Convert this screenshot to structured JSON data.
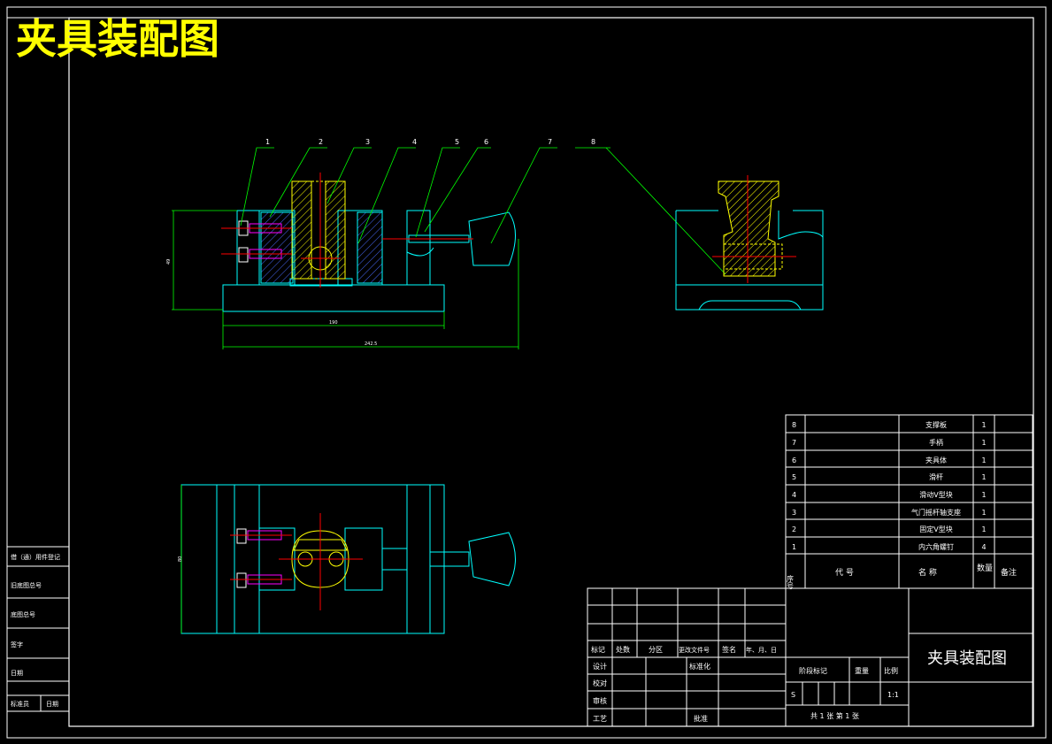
{
  "drawing_title": "夹具装配图",
  "colors": {
    "background": "#000000",
    "border": "#ffffff",
    "outline": "#00ffff",
    "leader": "#00ff00",
    "section": "#ffff00",
    "centerline": "#ff0000",
    "bolt": "#ff00ff"
  },
  "balloons": [
    "1",
    "2",
    "3",
    "4",
    "5",
    "6",
    "7",
    "8"
  ],
  "dims": {
    "height": "49",
    "length_base": "190",
    "length_total": "242.5",
    "width_plan": "80"
  },
  "left_strip": [
    "借（通）用件登记",
    "旧底图总号",
    "底图总号",
    "签字",
    "日期",
    "标准员",
    "日期"
  ],
  "bom": {
    "rows": [
      {
        "seq": "8",
        "name": "支撑板",
        "qty": "1"
      },
      {
        "seq": "7",
        "name": "手柄",
        "qty": "1"
      },
      {
        "seq": "6",
        "name": "夹具体",
        "qty": "1"
      },
      {
        "seq": "5",
        "name": "滑杆",
        "qty": "1"
      },
      {
        "seq": "4",
        "name": "滑动V型块",
        "qty": "1"
      },
      {
        "seq": "3",
        "name": "气门摇杆轴支座",
        "qty": "1"
      },
      {
        "seq": "2",
        "name": "固定V型块",
        "qty": "1"
      },
      {
        "seq": "1",
        "name": "内六角螺钉",
        "qty": "4"
      }
    ],
    "header": {
      "seq": "序号",
      "code": "代    号",
      "name": "名    称",
      "qty": "数量",
      "note": "备注"
    }
  },
  "title_block": {
    "revision_headers": [
      "标记",
      "处数",
      "分区",
      "更改文件号",
      "签名",
      "年、月、日"
    ],
    "roles": [
      "设计",
      "校对",
      "审核",
      "工艺"
    ],
    "standardization": "标准化",
    "approval": "批准",
    "stage_mark": "阶段标记",
    "weight": "重量",
    "scale_label": "比例",
    "stage_value": "S",
    "scale_value": "1:1",
    "sheet": "共 1 张    第 1 张",
    "drawing_name": "夹具装配图"
  }
}
